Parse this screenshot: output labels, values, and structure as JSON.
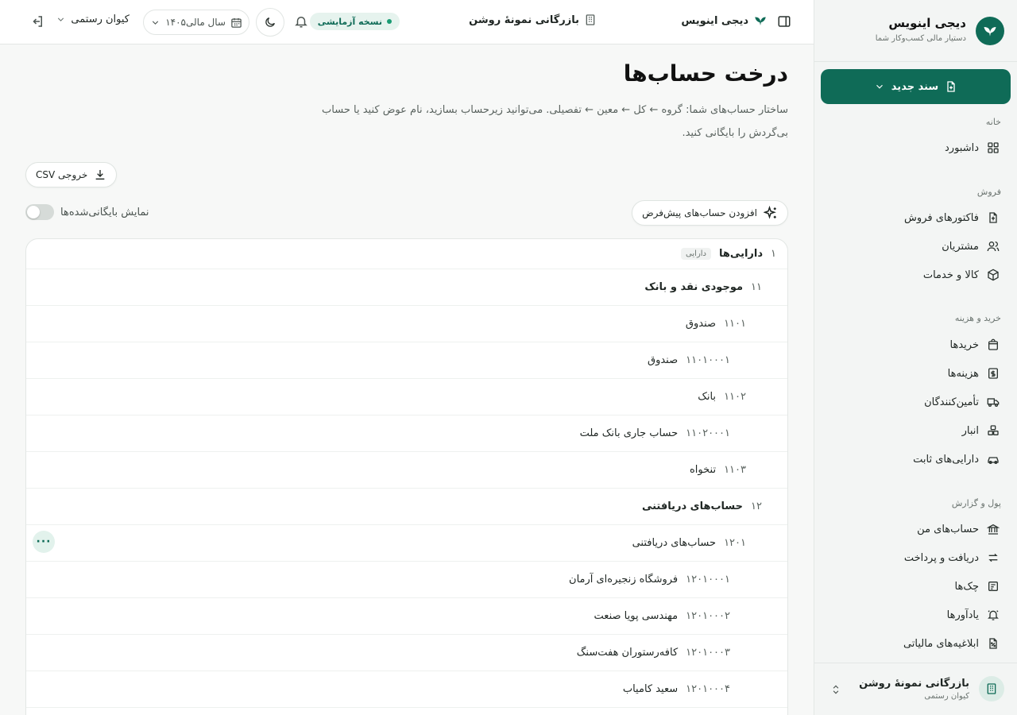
{
  "sidebar": {
    "brand_name": "دیجی اینویس",
    "brand_tagline": "دستیار مالی کسب‌وکار شما",
    "new_doc_label": "سند جدید",
    "sections": [
      {
        "title": "خانه",
        "items": [
          {
            "label": "داشبورد",
            "icon": "dashboard-icon"
          }
        ]
      },
      {
        "title": "فروش",
        "items": [
          {
            "label": "فاکتورهای فروش",
            "icon": "invoice-icon"
          },
          {
            "label": "مشتریان",
            "icon": "users-icon"
          },
          {
            "label": "کالا و خدمات",
            "icon": "box-icon"
          }
        ]
      },
      {
        "title": "خرید و هزینه",
        "items": [
          {
            "label": "خریدها",
            "icon": "shopping-bag-icon"
          },
          {
            "label": "هزینه‌ها",
            "icon": "receipt-icon"
          },
          {
            "label": "تأمین‌کنندگان",
            "icon": "truck-icon"
          },
          {
            "label": "انبار",
            "icon": "warehouse-icon"
          },
          {
            "label": "دارایی‌های ثابت",
            "icon": "car-icon"
          }
        ]
      },
      {
        "title": "پول و گزارش",
        "items": [
          {
            "label": "حساب‌های من",
            "icon": "bank-icon"
          },
          {
            "label": "دریافت و پرداخت",
            "icon": "transfer-icon"
          },
          {
            "label": "چک‌ها",
            "icon": "cheque-icon"
          },
          {
            "label": "یادآورها",
            "icon": "bell-ring-icon"
          },
          {
            "label": "ابلاغیه‌های مالیاتی",
            "icon": "tax-notice-icon"
          }
        ]
      }
    ],
    "company_name": "بازرگانی نمونهٔ روشن",
    "company_user": "کیوان رستمی"
  },
  "topbar": {
    "app_name": "دیجی اینویس",
    "company_name": "بازرگانی نمونهٔ روشن",
    "trial_badge": "نسخه آزمایشی",
    "fiscal_year": "سال مالی۱۴۰۵",
    "user_name": "کیوان رستمی"
  },
  "page": {
    "title": "درخت حساب‌ها",
    "description": "ساختار حساب‌های شما: گروه ← کل ← معین ← تفصیلی. می‌توانید زیرحساب بسازید، نام عوض کنید یا حساب بی‌گردش را بایگانی کنید.",
    "csv_button": "خروجی CSV",
    "add_defaults_button": "افزودن حساب‌های پیش‌فرض",
    "show_archived_label": "نمایش بایگانی‌شده‌ها",
    "show_archived": false
  },
  "tree": {
    "rows": [
      {
        "code": "۱",
        "name": "دارایی‌ها",
        "tag": "دارایی",
        "level": 0
      },
      {
        "code": "۱۱",
        "name": "موجودی نقد و بانک",
        "level": 1
      },
      {
        "code": "۱۱۰۱",
        "name": "صندوق",
        "level": 2
      },
      {
        "code": "۱۱۰۱۰۰۰۱",
        "name": "صندوق",
        "level": 3
      },
      {
        "code": "۱۱۰۲",
        "name": "بانک",
        "level": 2
      },
      {
        "code": "۱۱۰۲۰۰۰۱",
        "name": "حساب جاری بانک ملت",
        "level": 3
      },
      {
        "code": "۱۱۰۳",
        "name": "تنخواه",
        "level": 2
      },
      {
        "code": "۱۲",
        "name": "حساب‌های دریافتنی",
        "level": 1
      },
      {
        "code": "۱۲۰۱",
        "name": "حساب‌های دریافتنی",
        "level": 2,
        "menu": "···"
      },
      {
        "code": "۱۲۰۱۰۰۰۱",
        "name": "فروشگاه زنجیره‌ای آرمان",
        "level": 3
      },
      {
        "code": "۱۲۰۱۰۰۰۲",
        "name": "مهندسی پویا صنعت",
        "level": 3
      },
      {
        "code": "۱۲۰۱۰۰۰۳",
        "name": "کافه‌رستوران هفت‌سنگ",
        "level": 3
      },
      {
        "code": "۱۲۰۱۰۰۰۴",
        "name": "سعید کامیاب",
        "level": 3
      }
    ]
  },
  "colors": {
    "brand": "#0f6b57",
    "badge_bg": "#e6f3ee",
    "page_bg": "#f7f8f7"
  }
}
